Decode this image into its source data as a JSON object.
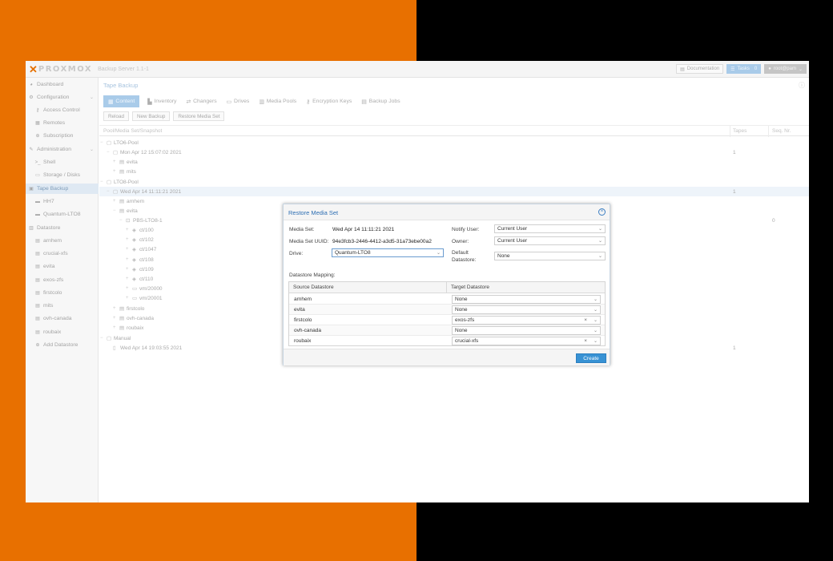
{
  "app": {
    "logo_text": "PROXMOX",
    "subtitle": "Backup Server 1.1-1",
    "documentation_label": "Documentation",
    "tasks_label": "Tasks",
    "tasks_count": "0",
    "user_label": "root@pam"
  },
  "sidebar": {
    "items": [
      {
        "label": "Dashboard",
        "icon": "dashboard-icon"
      },
      {
        "label": "Configuration",
        "icon": "gears-icon"
      },
      {
        "label": "Access Control",
        "icon": "key-icon"
      },
      {
        "label": "Remotes",
        "icon": "server-icon"
      },
      {
        "label": "Subscription",
        "icon": "support-icon"
      },
      {
        "label": "Administration",
        "icon": "wrench-icon"
      },
      {
        "label": "Shell",
        "icon": "terminal-icon"
      },
      {
        "label": "Storage / Disks",
        "icon": "hdd-icon"
      },
      {
        "label": "Tape Backup",
        "icon": "tape-icon"
      },
      {
        "label": "HH7",
        "icon": "drive-icon"
      },
      {
        "label": "Quantum-LTO8",
        "icon": "drive-icon"
      },
      {
        "label": "Datastore",
        "icon": "archive-icon"
      },
      {
        "label": "arnhem",
        "icon": "database-icon"
      },
      {
        "label": "crucial-xfs",
        "icon": "database-icon"
      },
      {
        "label": "evita",
        "icon": "database-icon"
      },
      {
        "label": "exos-zfs",
        "icon": "database-icon"
      },
      {
        "label": "firstcolo",
        "icon": "database-icon"
      },
      {
        "label": "mits",
        "icon": "database-icon"
      },
      {
        "label": "ovh-canada",
        "icon": "database-icon"
      },
      {
        "label": "roubaix",
        "icon": "database-icon"
      },
      {
        "label": "Add Datastore",
        "icon": "plus-circle-icon"
      }
    ]
  },
  "main": {
    "title": "Tape Backup",
    "tabs": [
      {
        "label": "Content",
        "icon": "grid-icon"
      },
      {
        "label": "Inventory",
        "icon": "tape-icon"
      },
      {
        "label": "Changers",
        "icon": "exchange-icon"
      },
      {
        "label": "Drives",
        "icon": "drive-icon"
      },
      {
        "label": "Media Pools",
        "icon": "pools-icon"
      },
      {
        "label": "Encryption Keys",
        "icon": "key-icon"
      },
      {
        "label": "Backup Jobs",
        "icon": "backup-icon"
      }
    ],
    "toolbar": {
      "reload": "Reload",
      "new_backup": "New Backup",
      "restore_media_set": "Restore Media Set"
    },
    "columns": {
      "name": "Pool/Media Set/Snapshot",
      "tapes": "Tapes",
      "seq": "Seq. Nr."
    },
    "tree": [
      {
        "label": "LTO6-Pool",
        "icon": "folder-icon",
        "tapes": "",
        "seq": ""
      },
      {
        "label": "Mon Apr 12 15:07:02 2021",
        "icon": "folder-icon",
        "tapes": "1",
        "seq": ""
      },
      {
        "label": "evita",
        "icon": "database-icon",
        "tapes": "",
        "seq": ""
      },
      {
        "label": "mits",
        "icon": "database-icon",
        "tapes": "",
        "seq": ""
      },
      {
        "label": "LTO8-Pool",
        "icon": "folder-icon",
        "tapes": "",
        "seq": ""
      },
      {
        "label": "Wed Apr 14 11:11:21 2021",
        "icon": "folder-icon",
        "tapes": "1",
        "seq": ""
      },
      {
        "label": "arnhem",
        "icon": "database-icon",
        "tapes": "",
        "seq": ""
      },
      {
        "label": "evita",
        "icon": "database-icon",
        "tapes": "",
        "seq": ""
      },
      {
        "label": "PBS-LTO8-1",
        "icon": "tape-icon",
        "tapes": "",
        "seq": "0"
      },
      {
        "label": "ct/100",
        "icon": "cube-icon",
        "tapes": "",
        "seq": ""
      },
      {
        "label": "ct/102",
        "icon": "cube-icon",
        "tapes": "",
        "seq": ""
      },
      {
        "label": "ct/1047",
        "icon": "cube-icon",
        "tapes": "",
        "seq": ""
      },
      {
        "label": "ct/108",
        "icon": "cube-icon",
        "tapes": "",
        "seq": ""
      },
      {
        "label": "ct/109",
        "icon": "cube-icon",
        "tapes": "",
        "seq": ""
      },
      {
        "label": "ct/110",
        "icon": "cube-icon",
        "tapes": "",
        "seq": ""
      },
      {
        "label": "vm/20000",
        "icon": "desktop-icon",
        "tapes": "",
        "seq": ""
      },
      {
        "label": "vm/20001",
        "icon": "desktop-icon",
        "tapes": "",
        "seq": ""
      },
      {
        "label": "firstcolo",
        "icon": "database-icon",
        "tapes": "",
        "seq": ""
      },
      {
        "label": "ovh-canada",
        "icon": "database-icon",
        "tapes": "",
        "seq": ""
      },
      {
        "label": "roubaix",
        "icon": "database-icon",
        "tapes": "",
        "seq": ""
      },
      {
        "label": "Manual",
        "icon": "folder-icon",
        "tapes": "",
        "seq": ""
      },
      {
        "label": "Wed Apr 14 19:03:55 2021",
        "icon": "file-icon",
        "tapes": "1",
        "seq": ""
      }
    ]
  },
  "dialog": {
    "title": "Restore Media Set",
    "media_set_label": "Media Set:",
    "media_set_value": "Wed Apr 14 11:11:21 2021",
    "uuid_label": "Media Set UUID:",
    "uuid_value": "94e3fcb3-2446-4412-a3d5-31a73ebe00a2",
    "drive_label": "Drive:",
    "drive_value": "Quantum-LTO8",
    "notify_label": "Notify User:",
    "notify_value": "Current User",
    "owner_label": "Owner:",
    "owner_value": "Current User",
    "default_ds_label_1": "Default",
    "default_ds_label_2": "Datastore:",
    "default_ds_value": "None",
    "mapping_label": "Datastore Mapping:",
    "mapping_columns": {
      "source": "Source Datastore",
      "target": "Target Datastore"
    },
    "mapping": [
      {
        "source": "arnhem",
        "target": "None",
        "clearable": false
      },
      {
        "source": "evita",
        "target": "None",
        "clearable": false
      },
      {
        "source": "firstcolo",
        "target": "exos-zfs",
        "clearable": true
      },
      {
        "source": "ovh-canada",
        "target": "None",
        "clearable": false
      },
      {
        "source": "roubaix",
        "target": "crucial-xfs",
        "clearable": true
      }
    ],
    "create_label": "Create"
  }
}
